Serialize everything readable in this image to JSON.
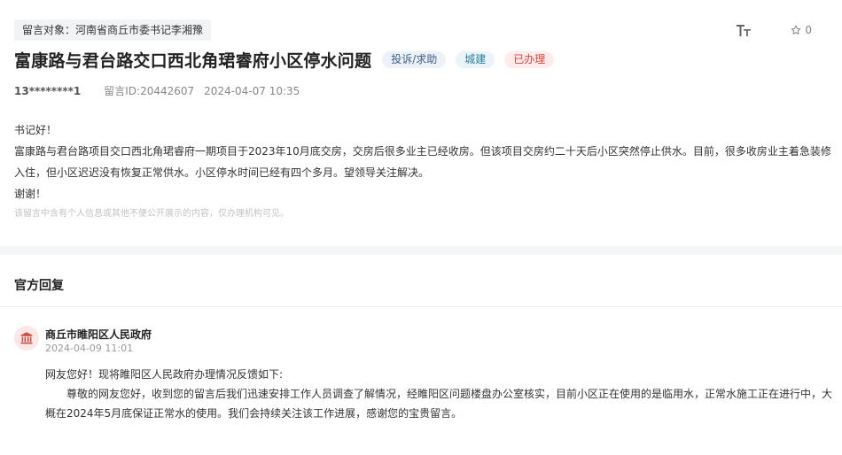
{
  "message": {
    "target": "留言对象：河南省商丘市委书记李湘豫",
    "title": "富康路与君台路交口西北角珺睿府小区停水问题",
    "tags": {
      "type": "投诉/求助",
      "field": "城建",
      "status": "已办理"
    },
    "user": "13********1",
    "message_id": "留言ID:20442607",
    "datetime": "2024-04-07 10:35",
    "content": [
      "书记好！",
      "富康路与君台路项目交口西北角珺睿府一期项目于2023年10月底交房，交房后很多业主已经收房。但该项目交房约二十天后小区突然停止供水。目前，很多收房业主着急装修入住，但小区迟迟没有恢复正常供水。小区停水时间已经有四个多月。望领导关注解决。",
      "谢谢！"
    ],
    "privacy_note": "该留言中含有个人信息或其他不便公开展示的内容，仅办理机构可见。"
  },
  "toolbar": {
    "font_icon": "font-size-icon",
    "star_icon": "star-icon",
    "star_count": "0"
  },
  "reply": {
    "heading": "官方回复",
    "org_icon": "government-building-icon",
    "org_name": "商丘市睢阳区人民政府",
    "time": "2024-04-09 11:01",
    "greeting": "网友您好！现将睢阳区人民政府办理情况反馈如下:",
    "body": "尊敬的网友您好，收到您的留言后我们迅速安排工作人员调查了解情况，经睢阳区问题楼盘办公室核实，目前小区正在使用的是临用水，正常水施工正在进行中，大概在2024年5月底保证正常水的使用。我们会持续关注该工作进展，感谢您的宝贵留言。"
  },
  "colors": {
    "status_red": "#d9453a",
    "field_teal": "#2d7f9c",
    "type_blue": "#3f5d86",
    "org_red": "#c94f44"
  }
}
